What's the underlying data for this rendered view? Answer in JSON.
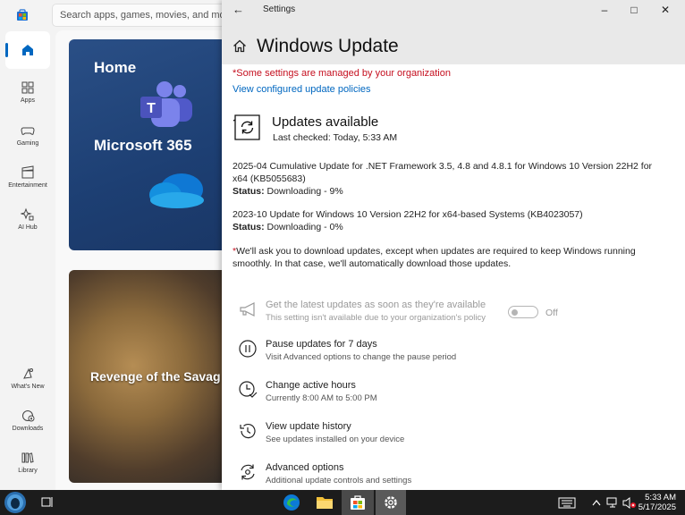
{
  "store": {
    "search_placeholder": "Search apps, games, movies, and more",
    "nav": [
      {
        "label": "",
        "icon": "home-icon"
      },
      {
        "label": "Apps",
        "icon": "apps-icon"
      },
      {
        "label": "Gaming",
        "icon": "gamepad-icon"
      },
      {
        "label": "Entertainment",
        "icon": "film-icon"
      },
      {
        "label": "AI Hub",
        "icon": "ai-hub-icon"
      },
      {
        "label": "What's New",
        "icon": "whats-new-icon"
      },
      {
        "label": "Downloads",
        "icon": "downloads-icon"
      },
      {
        "label": "Library",
        "icon": "library-icon"
      }
    ],
    "hero_title": "Home",
    "hero_subtitle": "Microsoft 365",
    "game_title": "Revenge of the Savag"
  },
  "settings": {
    "window_title": "Settings",
    "page_title": "Windows Update",
    "managed_notice": "*Some settings are managed by your organization",
    "policies_link": "View configured update policies",
    "status_title": "Updates available",
    "last_checked": "Last checked: Today, 5:33 AM",
    "updates": [
      {
        "name": "2025-04 Cumulative Update for .NET Framework 3.5, 4.8 and 4.8.1 for Windows 10 Version 22H2 for x64 (KB5055683)",
        "status_label": "Status:",
        "status": " Downloading - 9%"
      },
      {
        "name": "2023-10 Update for Windows 10 Version 22H2 for x64-based Systems (KB4023057)",
        "status_label": "Status:",
        "status": " Downloading - 0%"
      }
    ],
    "notice_star": "*",
    "notice": "We'll ask you to download updates, except when updates are required to keep Windows running smoothly. In that case, we'll automatically download those updates.",
    "options": [
      {
        "title": "Get the latest updates as soon as they're available",
        "desc": "This setting isn't available due to your organization's policy",
        "icon": "megaphone-icon"
      },
      {
        "title": "Pause updates for 7 days",
        "desc": "Visit Advanced options to change the pause period",
        "icon": "pause-icon"
      },
      {
        "title": "Change active hours",
        "desc": "Currently 8:00 AM to 5:00 PM",
        "icon": "clock-icon"
      },
      {
        "title": "View update history",
        "desc": "See updates installed on your device",
        "icon": "history-icon"
      },
      {
        "title": "Advanced options",
        "desc": "Additional update controls and settings",
        "icon": "gear-refresh-icon"
      }
    ],
    "toggle_label": "Off"
  },
  "taskbar": {
    "time": "5:33 AM",
    "date": "5/17/2025"
  },
  "colors": {
    "accent": "#0067c0",
    "warning": "#c50f1f",
    "taskbar": "#1c1c1c"
  }
}
